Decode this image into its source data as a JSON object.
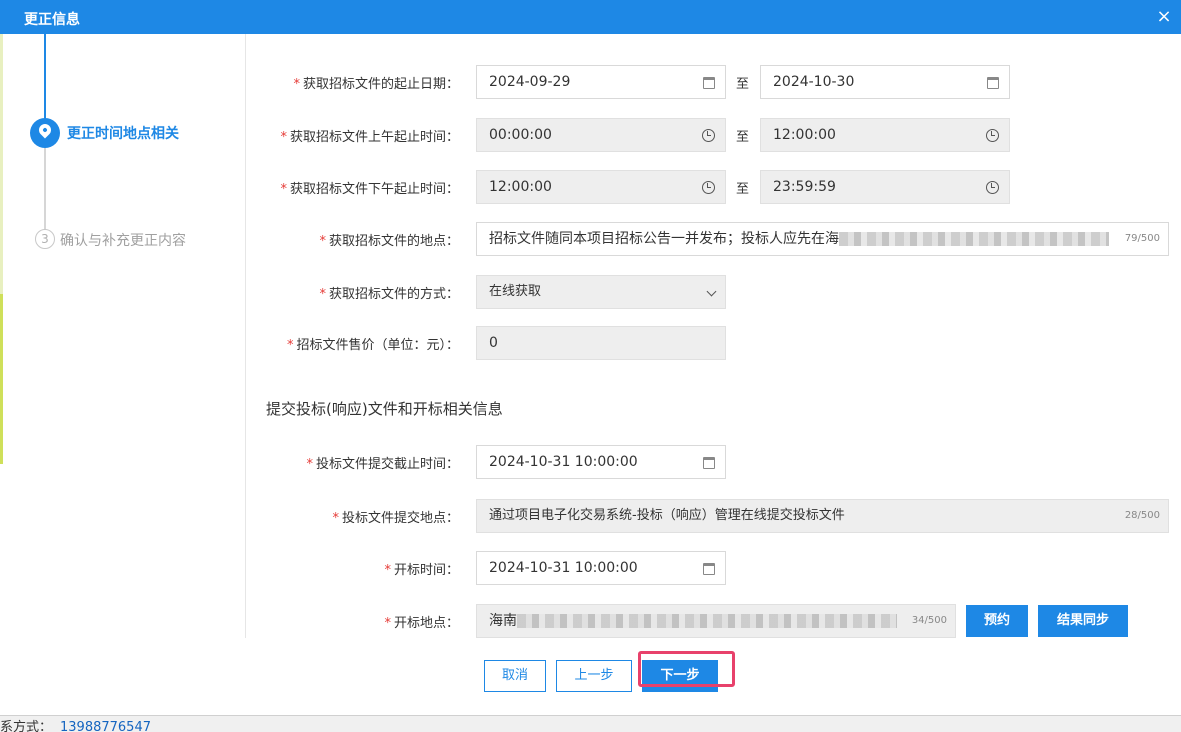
{
  "dialog": {
    "title": "更正信息",
    "close_label": "×"
  },
  "steps": [
    {
      "label": "更正时间地点相关",
      "active": true
    },
    {
      "number": "3",
      "label": "确认与补充更正内容",
      "active": false
    }
  ],
  "form": {
    "date_range": {
      "label": "获取招标文件的起止日期：",
      "start": "2024-09-29",
      "sep": "至",
      "end": "2024-10-30"
    },
    "morning_time": {
      "label": "获取招标文件上午起止时间：",
      "start": "00:00:00",
      "sep": "至",
      "end": "12:00:00"
    },
    "afternoon_time": {
      "label": "获取招标文件下午起止时间：",
      "start": "12:00:00",
      "sep": "至",
      "end": "23:59:59"
    },
    "location": {
      "label": "获取招标文件的地点：",
      "value": "招标文件随同本项目招标公告一并发布；投标人应先在海",
      "counter": "79/500"
    },
    "method": {
      "label": "获取招标文件的方式：",
      "value": "在线获取"
    },
    "price": {
      "label": "招标文件售价（单位：元）：",
      "value": "0"
    }
  },
  "section": {
    "title": "提交投标(响应)文件和开标相关信息"
  },
  "submission": {
    "deadline": {
      "label": "投标文件提交截止时间：",
      "value": "2024-10-31 10:00:00"
    },
    "place": {
      "label": "投标文件提交地点：",
      "value": "通过项目电子化交易系统-投标（响应）管理在线提交投标文件",
      "counter": "28/500"
    },
    "open_time": {
      "label": "开标时间：",
      "value": "2024-10-31 10:00:00"
    },
    "open_place": {
      "label": "开标地点：",
      "value": "海南",
      "counter": "34/500"
    },
    "reserve_label": "预约",
    "sync_label": "结果同步"
  },
  "footer": {
    "cancel_label": "取消",
    "prev_label": "上一步",
    "next_label": "下一步"
  },
  "background": {
    "contact_label": "系方式：",
    "phone": "13988776547"
  },
  "colors": {
    "primary": "#1e88e5",
    "required": "#e53935",
    "highlight": "#e8416b"
  }
}
